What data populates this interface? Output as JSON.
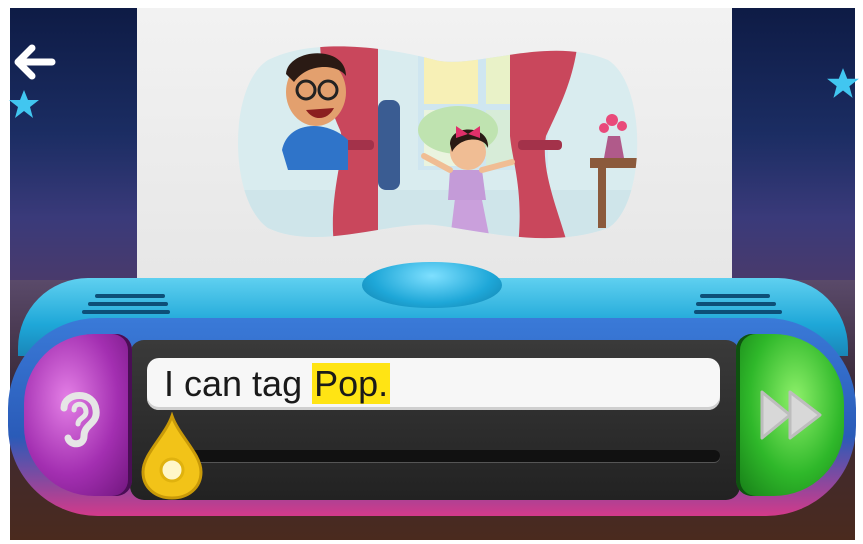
{
  "player": {
    "sentence_before": "I can tag",
    "sentence_highlight": "Pop."
  },
  "icons": {
    "back": "back-arrow-icon",
    "listen": "ear-icon",
    "next": "fast-forward-icon",
    "star": "star-icon"
  },
  "colors": {
    "highlight": "#ffe414",
    "console_blue": "#1ea7d8",
    "listen_button": "#a32fb1",
    "next_button": "#2fb82a",
    "slider": "#f2c318"
  },
  "progress": {
    "value": 0
  }
}
